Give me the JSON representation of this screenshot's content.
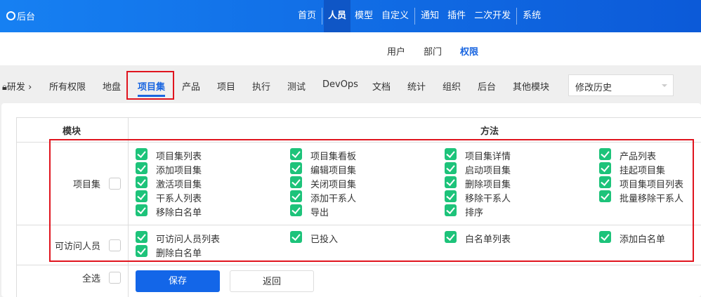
{
  "topbar": {
    "brand": "后台",
    "nav": [
      "首页",
      "人员",
      "模型",
      "自定义",
      "通知",
      "插件",
      "二次开发",
      "系统"
    ],
    "active": "人员"
  },
  "subnav": {
    "items": [
      "用户",
      "部门",
      "权限"
    ],
    "active": "权限"
  },
  "tabs": {
    "lead": "研发",
    "items": [
      "所有权限",
      "地盘",
      "项目集",
      "产品",
      "项目",
      "执行",
      "测试",
      "DevOps",
      "文档",
      "统计",
      "组织",
      "后台",
      "其他模块"
    ],
    "active": "项目集"
  },
  "history_select": "修改历史",
  "table": {
    "col_module": "模块",
    "col_method": "方法",
    "rows": [
      {
        "module": "项目集",
        "checked": false,
        "methods": [
          {
            "label": "项目集列表",
            "checked": true
          },
          {
            "label": "项目集看板",
            "checked": true
          },
          {
            "label": "项目集详情",
            "checked": true
          },
          {
            "label": "产品列表",
            "checked": true
          },
          {
            "label": "添加项目集",
            "checked": true
          },
          {
            "label": "编辑项目集",
            "checked": true
          },
          {
            "label": "启动项目集",
            "checked": true
          },
          {
            "label": "挂起项目集",
            "checked": true
          },
          {
            "label": "激活项目集",
            "checked": true
          },
          {
            "label": "关闭项目集",
            "checked": true
          },
          {
            "label": "删除项目集",
            "checked": true
          },
          {
            "label": "项目集项目列表",
            "checked": true
          },
          {
            "label": "干系人列表",
            "checked": true
          },
          {
            "label": "添加干系人",
            "checked": true
          },
          {
            "label": "移除干系人",
            "checked": true
          },
          {
            "label": "批量移除干系人",
            "checked": true
          },
          {
            "label": "移除白名单",
            "checked": true
          },
          {
            "label": "导出",
            "checked": true
          },
          {
            "label": "排序",
            "checked": true
          }
        ]
      },
      {
        "module": "可访问人员",
        "checked": false,
        "methods": [
          {
            "label": "可访问人员列表",
            "checked": true
          },
          {
            "label": "已投入",
            "checked": true
          },
          {
            "label": "白名单列表",
            "checked": true
          },
          {
            "label": "添加白名单",
            "checked": true
          },
          {
            "label": "删除白名单",
            "checked": true
          }
        ]
      }
    ],
    "select_all": "全选"
  },
  "buttons": {
    "save": "保存",
    "back": "返回"
  }
}
